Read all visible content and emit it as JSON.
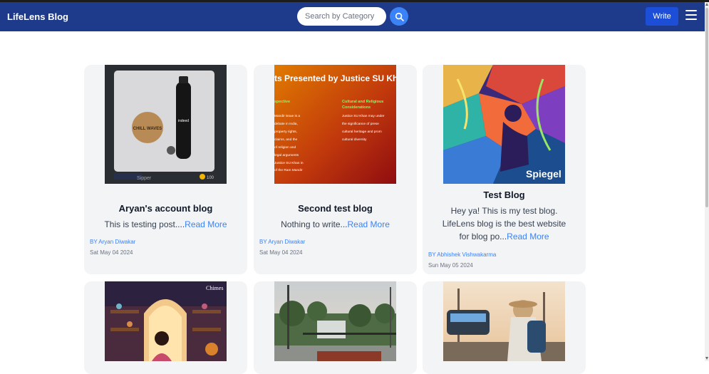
{
  "navbar": {
    "brand": "LifeLens Blog",
    "search_placeholder": "Search by Category",
    "write_label": "Write"
  },
  "posts": [
    {
      "title": "Aryan's account blog",
      "excerpt": "This is testing post....",
      "read_more": "Read More",
      "author": "BY Aryan Diwakar",
      "date": "Sat May 04 2024",
      "image": {
        "product_label": "Sipper",
        "badge_logo": "indeed",
        "coaster_text": "CHILL WAVES",
        "coin_count": "100"
      }
    },
    {
      "title": "Second test blog",
      "excerpt": "Nothing to write...",
      "read_more": "Read More",
      "author": "BY Aryan Diwakar",
      "date": "Sat May 04 2024",
      "image": {
        "heading": "ts Presented by Justice SU Kha",
        "col1_title": "spective",
        "col1_text": "Mandir issue is a debate in India, property rights, claims, and the of religion and legal arguments Justice SU Khan in of the Ram Mandir",
        "col2_title": "Cultural and Religious Considerations",
        "col2_text": "Justice SU Khan may under the significance of prese cultural heritage and prom cultural diversity"
      }
    },
    {
      "title": "Test Blog",
      "excerpt": "Hey ya! This is my test blog. LifeLens blog is the best website for blog po...",
      "read_more": "Read More",
      "author": "BY Abhishek Vishwakarma",
      "date": "Sun May 05 2024",
      "image": {
        "overlay_text": "Spiegel"
      }
    },
    {
      "title": "",
      "excerpt": "",
      "image": {
        "corner_text": "Chimes"
      }
    },
    {
      "title": "",
      "excerpt": "",
      "image": {}
    },
    {
      "title": "",
      "excerpt": "",
      "image": {}
    }
  ],
  "colors": {
    "navbar": "#1e3a8a",
    "accent": "#3b82f6",
    "write_button": "#1d4ed8",
    "card_bg": "#f3f4f6"
  }
}
